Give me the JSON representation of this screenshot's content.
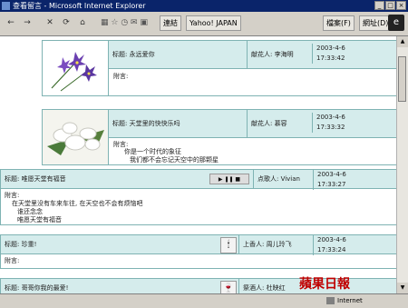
{
  "window": {
    "title": "查看留言 - Microsoft Internet Explorer"
  },
  "toolbar": {
    "back_label": "←",
    "forward_label": "→",
    "stop_label": "✕",
    "refresh_label": "⟳",
    "home_label": "⌂",
    "links_label": "連結",
    "yahoo_label": "Yahoo! JAPAN",
    "file_menu": "檔案(F)",
    "url_label": "網址(D)"
  },
  "cards": [
    {
      "title": "标题: 永远爱你",
      "sender_label": "献花人: 李海明",
      "date": "2003-4-6",
      "time": "17:33:42",
      "note_label": "附言:",
      "note_lines": [],
      "image": "purple-flower-image"
    },
    {
      "title": "标题: 天堂里的快快乐吗",
      "sender_label": "献花人: 慕容",
      "date": "2003-4-6",
      "time": "17:33:32",
      "note_label": "附言:",
      "note_lines": [
        "你是一个时代的象征",
        "我们都不会忘记天空中的那颗星"
      ],
      "image": "white-flower-image"
    },
    {
      "title": "标题: 唯愿天堂有福音",
      "sender_label": "点歌人: Vivian",
      "date": "2003-4-6",
      "time": "17:33:27",
      "note_label": "附言:",
      "note_lines": [
        "在天堂里没有车来车往, 在天空也不会有烦恼吧",
        "谁还念念",
        "唯愿天堂有福音"
      ]
    },
    {
      "title": "标题: 珍重!",
      "sender_label": "上香人: 周儿玲飞",
      "date": "2003-4-6",
      "time": "17:33:24",
      "note_label": "附言:"
    },
    {
      "title": "标题: 哥哥你我的最爱!",
      "sender_label": "祭酒人: 杜映红"
    }
  ],
  "status": {
    "zone": "Internet"
  },
  "watermark": "蘋果日報"
}
